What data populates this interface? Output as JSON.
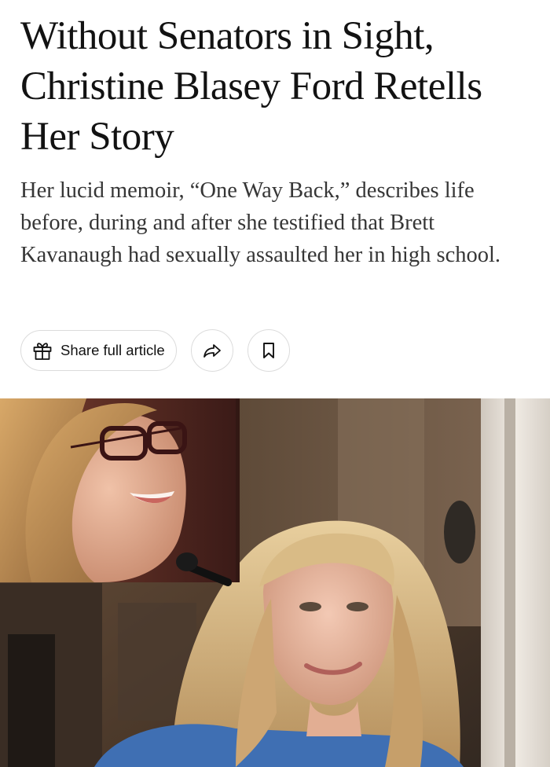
{
  "article": {
    "headline": "Without Senators in Sight, Christine Blasey Ford Retells Her Story",
    "summary": "Her lucid memoir, “One Way Back,” describes life before, during and after she testified that Brett Kavanaugh had sexually assaulted her in high school."
  },
  "actions": {
    "share_full_article_label": "Share full article",
    "gift_icon": "gift-icon",
    "share_icon": "share-arrow-icon",
    "bookmark_icon": "bookmark-icon"
  },
  "photo": {
    "description_icon": "photo-collage"
  }
}
